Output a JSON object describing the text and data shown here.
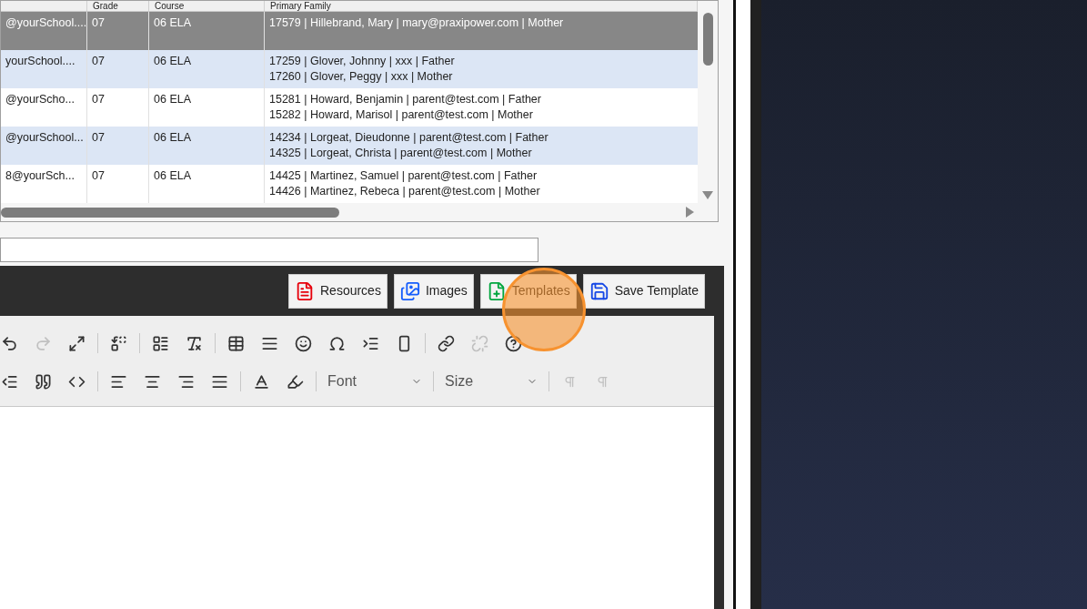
{
  "table": {
    "columns": [
      "",
      "Grade",
      "Course",
      "Primary Family"
    ],
    "rows": [
      {
        "selected": true,
        "cells": [
          "@yourSchool....",
          "07",
          "06 ELA"
        ],
        "family": [
          "17579 | Hillebrand, Mary | mary@praxipower.com | Mother"
        ]
      },
      {
        "selected": false,
        "cells": [
          "yourSchool....",
          "07",
          "06 ELA"
        ],
        "family": [
          "17259 | Glover, Johnny | xxx | Father",
          "17260 | Glover, Peggy | xxx | Mother"
        ]
      },
      {
        "selected": false,
        "cells": [
          "@yourScho...",
          "07",
          "06 ELA"
        ],
        "family": [
          "15281 | Howard, Benjamin | parent@test.com | Father",
          "15282 | Howard, Marisol | parent@test.com | Mother"
        ]
      },
      {
        "selected": false,
        "cells": [
          "@yourSchool...",
          "07",
          "06 ELA"
        ],
        "family": [
          "14234 | Lorgeat, Dieudonne | parent@test.com | Father",
          "14325 | Lorgeat, Christa | parent@test.com | Mother"
        ]
      },
      {
        "selected": false,
        "cells": [
          "8@yourSch...",
          "07",
          "06 ELA"
        ],
        "family": [
          "14425 | Martinez, Samuel | parent@test.com | Father",
          "14426 | Martinez, Rebeca | parent@test.com | Mother"
        ]
      }
    ]
  },
  "editor": {
    "buttons": [
      {
        "kind": "pdf",
        "label": "Resources",
        "highlighted": false
      },
      {
        "kind": "images",
        "label": "Images",
        "highlighted": false
      },
      {
        "kind": "template",
        "label": "Templates",
        "highlighted": true
      },
      {
        "kind": "save",
        "label": "Save Template",
        "highlighted": false
      }
    ],
    "toolbar_row_1": [
      {
        "disabled": false
      },
      {
        "disabled": true
      },
      {
        "disabled": false
      },
      {
        "disabled": false
      },
      {
        "disabled": false
      },
      {
        "disabled": false
      },
      {
        "disabled": false
      },
      {
        "disabled": false
      },
      {
        "disabled": false
      },
      {
        "disabled": false
      },
      {
        "disabled": false
      },
      {
        "disabled": false
      },
      {
        "disabled": false
      },
      {
        "disabled": true
      },
      {
        "disabled": false
      }
    ],
    "toolbar_row_2": [
      {
        "disabled": false
      },
      {
        "disabled": false
      },
      {
        "disabled": false
      },
      {
        "disabled": false
      },
      {
        "disabled": false
      },
      {
        "disabled": false
      },
      {
        "disabled": false
      },
      {
        "disabled": false
      },
      {
        "disabled": false
      }
    ],
    "font": {
      "label": "Font"
    },
    "size": {
      "label": "Size"
    },
    "direction_buttons": [
      {
        "disabled": true
      },
      {
        "disabled": true
      }
    ]
  }
}
